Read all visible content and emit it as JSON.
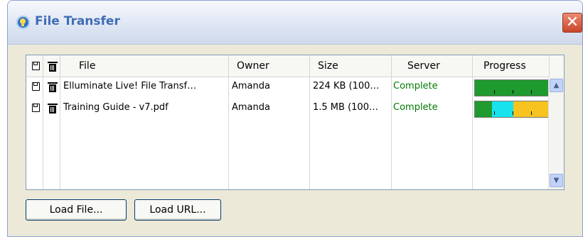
{
  "window": {
    "title": "File Transfer",
    "close_label": "✕"
  },
  "table": {
    "columns": {
      "file": "File",
      "owner": "Owner",
      "size": "Size",
      "server": "Server",
      "progress": "Progress"
    },
    "rows": [
      {
        "file": "Elluminate Live! File Transf…",
        "owner": "Amanda",
        "size": "224 KB (100…",
        "server": "Complete",
        "progress_segments": [
          {
            "color": "#1f9a2e",
            "fraction": 1.0
          }
        ]
      },
      {
        "file": "Training Guide - v7.pdf",
        "owner": "Amanda",
        "size": "1.5 MB (100…",
        "server": "Complete",
        "progress_segments": [
          {
            "color": "#1f9a2e",
            "fraction": 0.23
          },
          {
            "color": "#17e3ef",
            "fraction": 0.29
          },
          {
            "color": "#f7c41f",
            "fraction": 0.48
          }
        ]
      }
    ]
  },
  "buttons": {
    "load_file": "Load File...",
    "load_url": "Load URL..."
  },
  "icons": {
    "save": "save-icon",
    "trash": "trash-icon",
    "scroll_up": "▲",
    "scroll_down": "▼"
  }
}
